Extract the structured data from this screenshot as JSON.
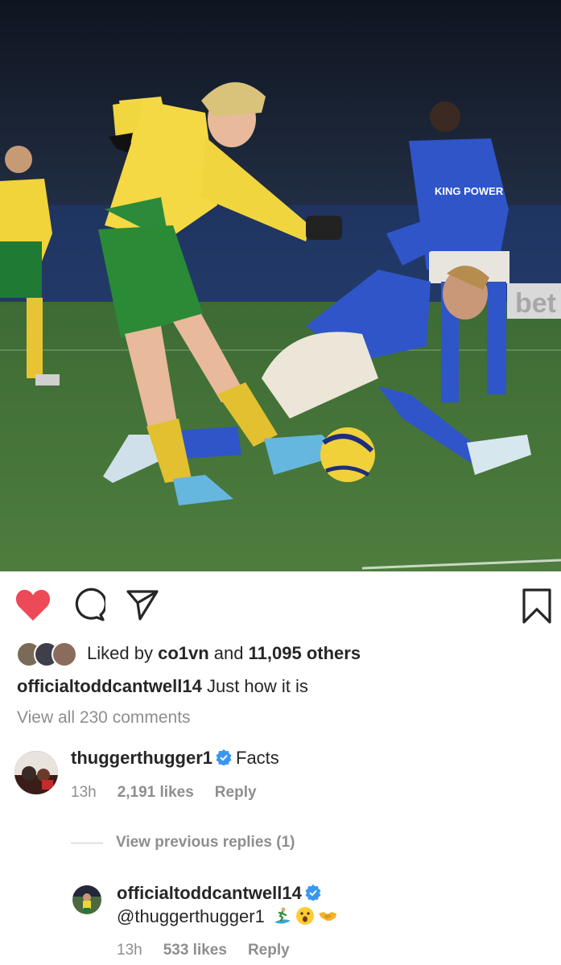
{
  "post": {
    "liked_prefix": "Liked by",
    "liked_user": "co1vn",
    "liked_and": "and",
    "liked_count": "11,095 others",
    "caption_user": "officialtoddcantwell14",
    "caption_text": "Just how it is",
    "view_all": "View all 230 comments",
    "sponsor_board_text": "bet",
    "shirt_text": "KING POWER"
  },
  "comments": [
    {
      "user": "thuggerthugger1",
      "text": "Facts",
      "time": "13h",
      "likes": "2,191 likes",
      "reply": "Reply"
    }
  ],
  "previous_replies": "View previous replies (1)",
  "reply": {
    "user": "officialtoddcantwell14",
    "mention": "@thuggerthugger1",
    "time": "13h",
    "likes": "533 likes",
    "reply": "Reply"
  },
  "icons": {
    "like": "heart-icon",
    "comment": "comment-icon",
    "share": "paper-plane-icon",
    "save": "bookmark-icon",
    "verified": "verified-badge-icon"
  },
  "colors": {
    "like": "#ed4956",
    "verified": "#3897f0",
    "muted": "#8e8e8e"
  }
}
